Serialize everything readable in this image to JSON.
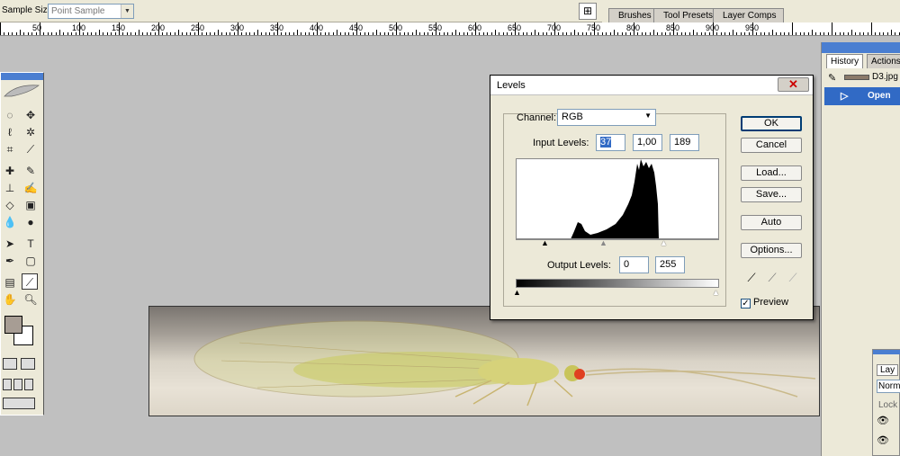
{
  "options_bar": {
    "sample_size_label": "Sample Size:",
    "sample_size_value": "Point Sample"
  },
  "palette_well": {
    "tabs": [
      "Brushes",
      "Tool Presets",
      "Layer Comps"
    ]
  },
  "ruler": {
    "labels": [
      "50",
      "100",
      "150",
      "200",
      "250",
      "300",
      "350",
      "400",
      "450",
      "500",
      "550",
      "600",
      "650",
      "700",
      "750",
      "800",
      "850",
      "900",
      "950"
    ]
  },
  "history_panel": {
    "tabs": [
      "History",
      "Actions"
    ],
    "snapshot": "D3.jpg",
    "steps": [
      "Open"
    ]
  },
  "layers_panel": {
    "tab": "Lay",
    "blend": "Norm",
    "lock": "Lock"
  },
  "levels_dialog": {
    "title": "Levels",
    "channel_label": "Channel:",
    "channel_value": "RGB",
    "input_levels_label": "Input Levels:",
    "input_black": "37",
    "input_gamma": "1,00",
    "input_white": "189",
    "output_levels_label": "Output Levels:",
    "output_black": "0",
    "output_white": "255",
    "buttons": {
      "ok": "OK",
      "cancel": "Cancel",
      "load": "Load...",
      "save": "Save...",
      "auto": "Auto",
      "options": "Options..."
    },
    "preview_label": "Preview",
    "preview_checked": true
  },
  "colors": {
    "foreground": "#a79d94",
    "background": "#ffffff",
    "selection": "#316ac5"
  }
}
